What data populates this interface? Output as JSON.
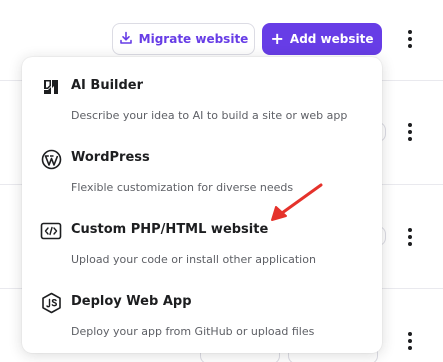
{
  "header": {
    "migrate_label": "Migrate website",
    "add_label": "Add website",
    "accent_color": "#673de6"
  },
  "menu": {
    "items": [
      {
        "title": "AI Builder",
        "description": "Describe your idea to AI to build a site or web app",
        "icon": "ai-builder-icon"
      },
      {
        "title": "WordPress",
        "description": "Flexible customization for diverse needs",
        "icon": "wordpress-icon"
      },
      {
        "title": "Custom PHP/HTML website",
        "description": "Upload your code or install other application",
        "icon": "code-icon"
      },
      {
        "title": "Deploy Web App",
        "description": "Deploy your app from GitHub or upload files",
        "icon": "nodejs-icon"
      }
    ]
  },
  "annotation": {
    "color": "#e5322b"
  }
}
